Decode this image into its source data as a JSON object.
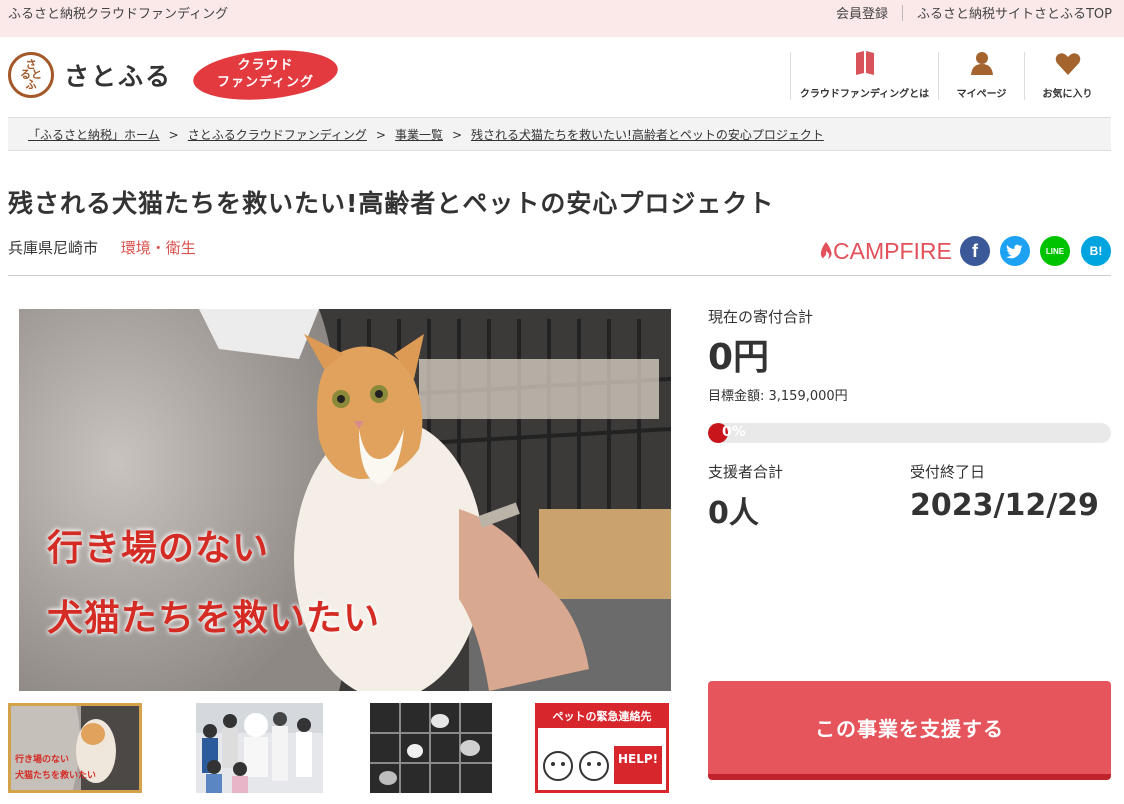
{
  "topbar": {
    "site_name": "ふるさと納税クラウドファンディング",
    "register": "会員登録",
    "satofull_top": "ふるさと納税サイトさとふるTOP"
  },
  "logo": {
    "name": "さとふる",
    "mark_text": "さ\nると\nふ"
  },
  "cf_badge": {
    "line1": "クラウド",
    "line2": "ファンディング"
  },
  "header_nav": [
    {
      "label": "クラウドファンディングとは",
      "icon": "book-icon"
    },
    {
      "label": "マイページ",
      "icon": "user-icon"
    },
    {
      "label": "お気に入り",
      "icon": "heart-icon"
    }
  ],
  "breadcrumb": [
    "「ふるさと納税」ホーム",
    "さとふるクラウドファンディング",
    "事業一覧",
    "残される犬猫たちを救いたい!高齢者とペットの安心プロジェクト"
  ],
  "project": {
    "title": "残される犬猫たちを救いたい!高齢者とペットの安心プロジェクト",
    "location": "兵庫県尼崎市",
    "category": "環境・衛生",
    "partner": "CAMPFIRE"
  },
  "share": [
    {
      "name": "facebook",
      "glyph": "f",
      "color": "#3b5998"
    },
    {
      "name": "twitter",
      "glyph": "t",
      "color": "#1da1f2"
    },
    {
      "name": "line",
      "glyph": "LINE",
      "color": "#00c300"
    },
    {
      "name": "hatena",
      "glyph": "B!",
      "color": "#00a4de"
    }
  ],
  "main_image": {
    "caption1": "行き場のない",
    "caption2": "犬猫たちを救いたい"
  },
  "thumbnails": [
    {
      "caption1": "行き場のない",
      "caption2": "犬猫たちを救いたい"
    },
    {},
    {},
    {
      "heading": "ペットの緊急連絡先",
      "help": "HELP!"
    }
  ],
  "stats": {
    "total_label": "現在の寄付合計",
    "total_value": "0円",
    "target": "目標金額: 3,159,000円",
    "progress_percent": 0,
    "progress_text": "0%",
    "supporters_label": "支援者合計",
    "supporters_value": "0人",
    "deadline_label": "受付終了日",
    "deadline_value": "2023/12/29"
  },
  "support_button": "この事業を支援する",
  "colors": {
    "accent": "#e6555c",
    "progress": "#c8141b",
    "category": "#d9534f",
    "topbar_bg": "#fbe9ea"
  }
}
